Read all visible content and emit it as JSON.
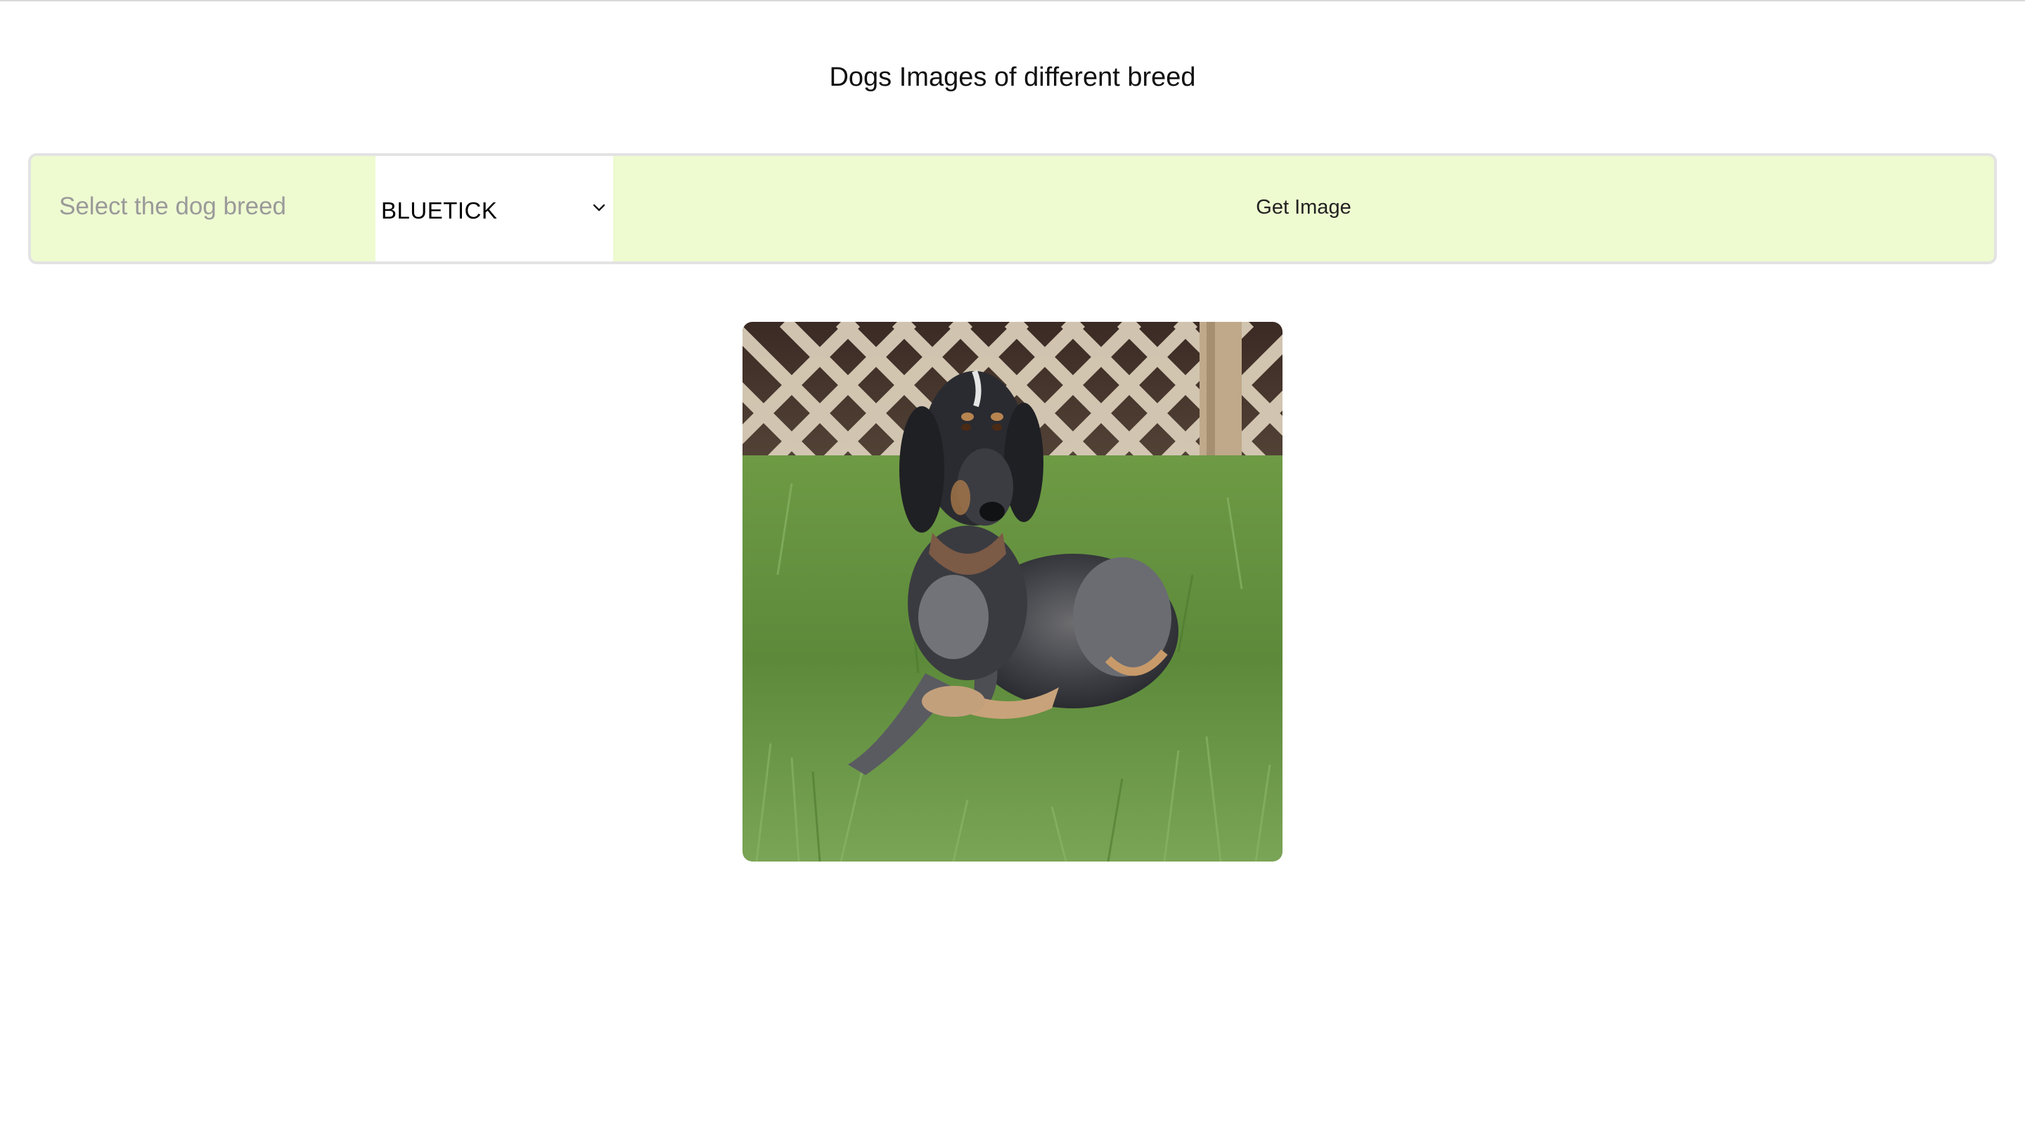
{
  "page": {
    "title": "Dogs Images of different breed"
  },
  "controls": {
    "label": "Select the dog breed",
    "select": {
      "selected": "BLUETICK"
    },
    "button_label": "Get Image"
  },
  "colors": {
    "panel_background": "#eefad0",
    "panel_border": "#e3e3e3",
    "label_text": "#9a9a9a"
  },
  "icons": {
    "dropdown": "chevron-down-icon"
  }
}
